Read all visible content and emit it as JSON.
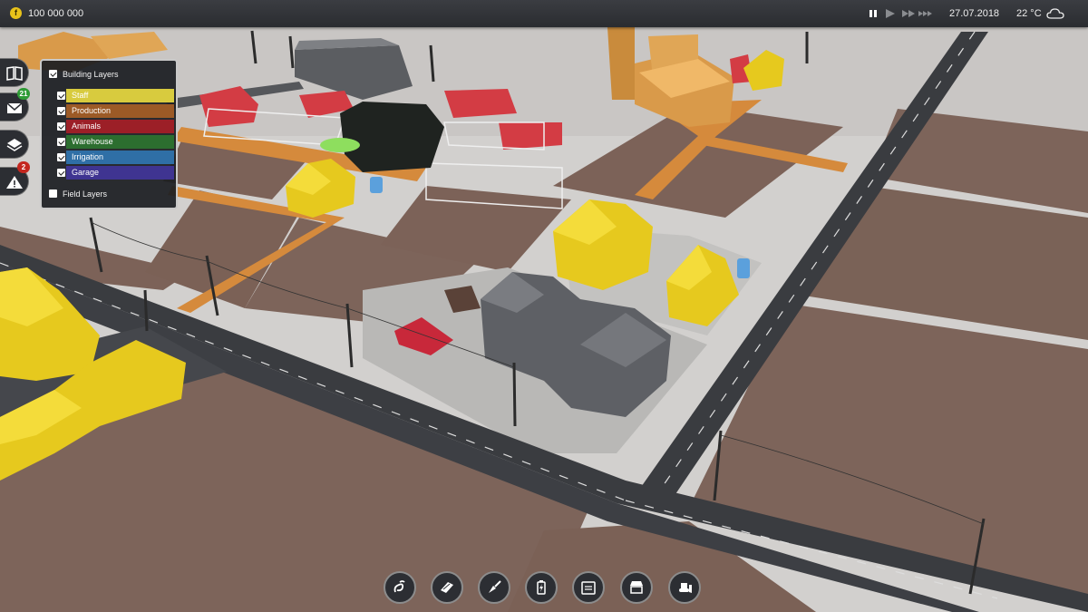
{
  "topbar": {
    "currency_icon": "coin-icon",
    "money": "100 000 000",
    "speed_controls": [
      "pause-icon",
      "play-icon",
      "fast-forward-icon",
      "fastest-forward-icon"
    ],
    "date": "27.07.2018",
    "temperature": "22 °C",
    "weather_icon": "cloud-icon"
  },
  "sidebar": {
    "buttons": [
      {
        "icon": "book-icon"
      },
      {
        "icon": "mail-icon",
        "badge": "21",
        "badge_color": "#2e9b35"
      },
      {
        "icon": "layers-icon"
      },
      {
        "icon": "warning-icon",
        "badge": "2",
        "badge_color": "#c4271f"
      }
    ]
  },
  "layers_panel": {
    "building_layers_label": "Building Layers",
    "building_layers_checked": true,
    "layers": [
      {
        "label": "Staff",
        "color": "#b9ae2e",
        "checked": true
      },
      {
        "label": "Production",
        "color": "#9c5a26",
        "checked": true
      },
      {
        "label": "Animals",
        "color": "#9c1f27",
        "checked": true
      },
      {
        "label": "Warehouse",
        "color": "#2c6e2f",
        "checked": true
      },
      {
        "label": "Irrigation",
        "color": "#2f6fa6",
        "checked": true
      },
      {
        "label": "Garage",
        "color": "#3f3491",
        "checked": true
      }
    ],
    "field_layers_label": "Field Layers",
    "field_layers_checked": false
  },
  "toolbar": {
    "tools": [
      "fertilizer-icon",
      "field-icon",
      "trowel-icon",
      "power-icon",
      "calendar-icon",
      "market-icon",
      "bulldozer-icon"
    ]
  },
  "colors": {
    "staff_building": "#e6c91e",
    "production_building": "#d99a4a",
    "animal_building": "#d33c44",
    "field": "#7d645a",
    "road": "#3a3c40"
  }
}
